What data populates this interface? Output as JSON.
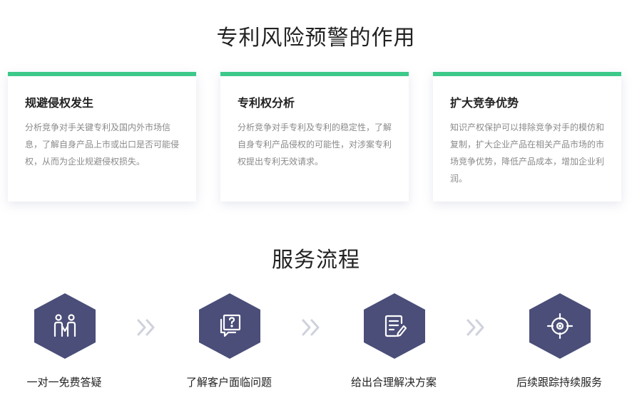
{
  "section1": {
    "title": "专利风险预警的作用",
    "cards": [
      {
        "title": "规避侵权发生",
        "lines": [
          "分析竞争对手关键专利及国内外市场信",
          "息，了解自身产品上市或出口是否可能侵",
          "权，从而为企业规避侵权损失。"
        ]
      },
      {
        "title": "专利权分析",
        "lines": [
          "分析竞争对手专利及专利的稳定性，了解",
          "自身专利产品侵权的可能性，对涉案专利",
          "权提出专利无效请求。"
        ]
      },
      {
        "title": "扩大竞争优势",
        "lines": [
          "知识产权保护可以排除竞争对手的模仿和",
          "复制，扩大企业产品在相关产品市场的市",
          "场竞争优势，降低产品成本，增加企业利",
          "润。"
        ]
      }
    ]
  },
  "section2": {
    "title": "服务流程",
    "steps": [
      {
        "label": "一对一免费答疑",
        "icon": "people-icon"
      },
      {
        "label": "了解客户面临问题",
        "icon": "question-chat-icon"
      },
      {
        "label": "给出合理解决方案",
        "icon": "document-edit-icon"
      },
      {
        "label": "后续跟踪持续服务",
        "icon": "target-icon"
      }
    ],
    "arrow_icon": "double-chevron-right-icon"
  },
  "colors": {
    "accent": "#3cc98a",
    "hexagon": "#4a4e78",
    "body_text": "#8a8a8a",
    "arrow": "#cfd2dc"
  }
}
